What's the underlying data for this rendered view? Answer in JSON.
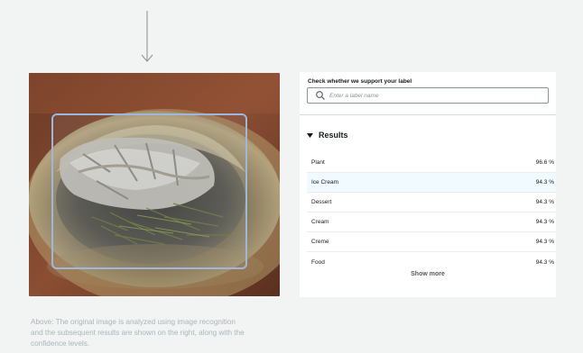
{
  "panel": {
    "check_label": "Check whether we support your label",
    "search_placeholder": "Enter a label name",
    "results_title": "Results",
    "results": [
      {
        "label": "Plant",
        "confidence": "96.6 %"
      },
      {
        "label": "Ice Cream",
        "confidence": "94.3 %"
      },
      {
        "label": "Dessert",
        "confidence": "94.3 %"
      },
      {
        "label": "Cream",
        "confidence": "94.3 %"
      },
      {
        "label": "Creme",
        "confidence": "94.3 %"
      },
      {
        "label": "Food",
        "confidence": "94.3 %"
      }
    ],
    "show_more": "Show more"
  },
  "caption": "Above: The original image is analyzed using image recognition and the subsequent results are shown on the right, along with the confidence levels.",
  "icons": {
    "arrow": "arrow-down-icon",
    "search": "search-icon",
    "caret": "caret-down-icon"
  },
  "colors": {
    "page_bg": "#f2f3f3",
    "panel_bg": "#ffffff",
    "highlight_row": "#f1faff",
    "bounding_box": "#9fb6dd",
    "caption_text": "#aab7b8"
  }
}
